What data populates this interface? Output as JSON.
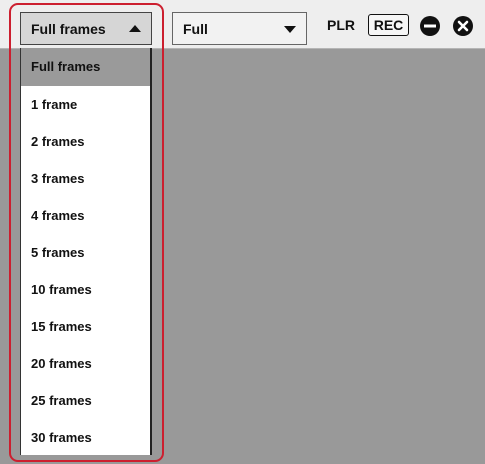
{
  "toolbar": {
    "frames_value": "Full frames",
    "resolution_value": "Full",
    "plr_label": "PLR",
    "rec_label": "REC",
    "minus_icon": "minus-circle-icon",
    "close_icon": "close-circle-icon"
  },
  "dropdown": {
    "options": [
      "Full frames",
      "1 frame",
      "2 frames",
      "3 frames",
      "4 frames",
      "5 frames",
      "10 frames",
      "15 frames",
      "20 frames",
      "25 frames",
      "30 frames"
    ],
    "selected_index": 0
  },
  "colors": {
    "highlight": "#cc1f2f",
    "content_background": "#999999",
    "selected_option": "#9a9a9a"
  }
}
